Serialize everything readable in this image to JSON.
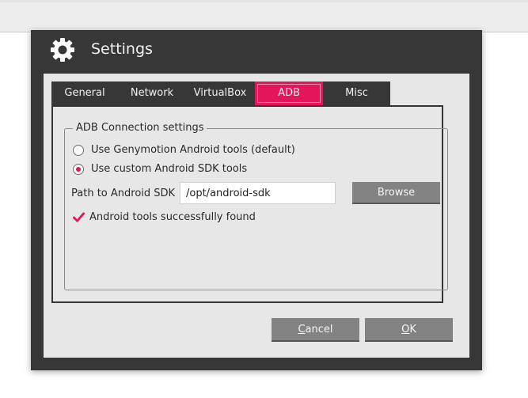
{
  "dialog": {
    "title": "Settings",
    "title_icon": "gear-icon"
  },
  "tabs": [
    {
      "label": "General",
      "active": false
    },
    {
      "label": "Network",
      "active": false
    },
    {
      "label": "VirtualBox",
      "active": false
    },
    {
      "label": "ADB",
      "active": true
    },
    {
      "label": "Misc",
      "active": false
    }
  ],
  "adb": {
    "group_title": "ADB Connection settings",
    "options": [
      {
        "label": "Use Genymotion Android tools (default)",
        "checked": false
      },
      {
        "label": "Use custom Android SDK tools",
        "checked": true
      }
    ],
    "path_label": "Path to Android SDK",
    "path_value": "/opt/android-sdk",
    "browse_label": "Browse",
    "status_text": "Android tools successfully found",
    "status_icon": "check-icon"
  },
  "buttons": {
    "cancel": {
      "mnemonic": "C",
      "rest": "ancel"
    },
    "ok": {
      "mnemonic": "O",
      "rest": "K"
    }
  },
  "colors": {
    "accent": "#e3165b",
    "dialog_bg": "#373737",
    "client_bg": "#e7e7e7",
    "button_bg": "#838383"
  }
}
